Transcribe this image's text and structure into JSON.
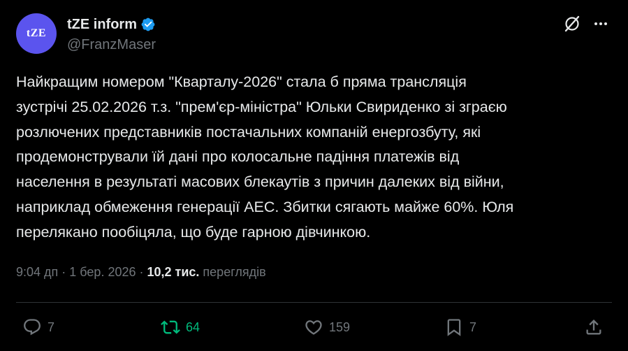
{
  "author": {
    "avatar_text": "tZE",
    "display_name": "tZE inform",
    "handle": "@FranzMaser",
    "verified": true
  },
  "post": {
    "text": "Найкращим номером \"Кварталу-2026\" стала б пряма трансляція\nзустрічі 25.02.2026 т.з. \"прем'єр-міністра\" Юльки Свириденко  зі зграєю\nрозлючених представників постачальних компаній енергозбуту, які\nпродемонстрували їй дані про колосальне падіння платежів від\nнаселення в результаті масових блекаутів з причин далеких від війни,\nнаприклад обмеження генерації АЕС.  Збитки сягають майже 60%. Юля\nперелякано пообіцяла, що буде гарною дівчинкою."
  },
  "meta": {
    "time": "9:04 дп",
    "separator": " · ",
    "date": "1 бер. 2026",
    "separator2": " · ",
    "views_count": "10,2 тис.",
    "views_label": " переглядів"
  },
  "actions": {
    "reply_count": "7",
    "retweet_count": "64",
    "like_count": "159",
    "bookmark_count": "7"
  },
  "colors": {
    "background": "#000000",
    "text_primary": "#e7e9ea",
    "text_secondary": "#71767b",
    "verified": "#1d9bf0",
    "retweet_active": "#00ba7c",
    "avatar_bg": "#5b54ee",
    "divider": "#2f3336"
  },
  "icons": {
    "verified": "verified-badge-icon",
    "grok": "grok-icon",
    "more": "more-icon",
    "reply": "reply-icon",
    "retweet": "retweet-icon",
    "like": "heart-icon",
    "bookmark": "bookmark-icon",
    "share": "share-icon"
  }
}
